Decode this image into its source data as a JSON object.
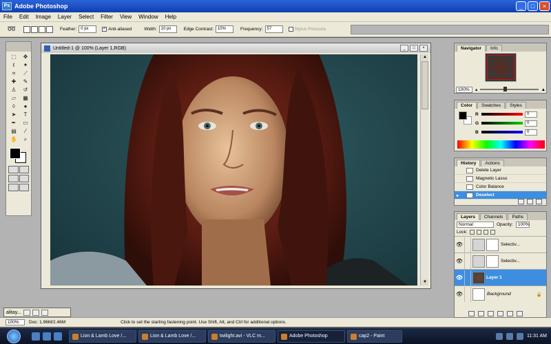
{
  "window": {
    "title": "Adobe Photoshop",
    "minimize": "_",
    "maximize": "□",
    "close": "×"
  },
  "menu": [
    "File",
    "Edit",
    "Image",
    "Layer",
    "Select",
    "Filter",
    "View",
    "Window",
    "Help"
  ],
  "options": {
    "feather_label": "Feather:",
    "feather_value": "0 px",
    "antialiased_label": "Anti-aliased",
    "width_label": "Width:",
    "width_value": "10 px",
    "edge_label": "Edge Contrast:",
    "edge_value": "10%",
    "frequency_label": "Frequency:",
    "frequency_value": "57",
    "stylus_label": "Stylus Pressure"
  },
  "document": {
    "title": "Untitled-1 @ 100% (Layer 1,RGB)"
  },
  "minimized_doc": {
    "title": "alitay..."
  },
  "status": {
    "zoom": "100%",
    "doc": "Doc: 1.96M/2.46M",
    "hint": "Click to set the starting fastening point. Use Shift, Alt, and Ctrl for additional options."
  },
  "navigator": {
    "tabs": [
      "Navigator",
      "Info"
    ],
    "zoom": "100%"
  },
  "color": {
    "tabs": [
      "Color",
      "Swatches",
      "Styles"
    ],
    "rows": [
      {
        "label": "R",
        "value": "0",
        "color": "#d22"
      },
      {
        "label": "G",
        "value": "0",
        "color": "#2a2"
      },
      {
        "label": "B",
        "value": "0",
        "color": "#22d"
      }
    ]
  },
  "history": {
    "tabs": [
      "History",
      "Actions"
    ],
    "items": [
      "Delete Layer",
      "Magnetic Lasso",
      "Color Balance",
      "Deselect"
    ]
  },
  "layers": {
    "tabs": [
      "Layers",
      "Channels",
      "Paths"
    ],
    "blend": "Normal",
    "opacity_label": "Opacity:",
    "opacity": "100%",
    "lock_label": "Lock:",
    "items": [
      "Selectiv...",
      "Selectiv...",
      "Layer 1",
      "Background"
    ]
  },
  "taskbar": {
    "tasks": [
      "Lion & Lamb Love /...",
      "Lion & Lamb Love /...",
      "twilight.avi - VLC m...",
      "Adobe Photoshop",
      "cap2 - Paint"
    ],
    "clock": "11:31 AM"
  },
  "icons": [
    "photoshop-icon",
    "magnetic-lasso-icon",
    "eye-icon",
    "start-orb-icon"
  ]
}
